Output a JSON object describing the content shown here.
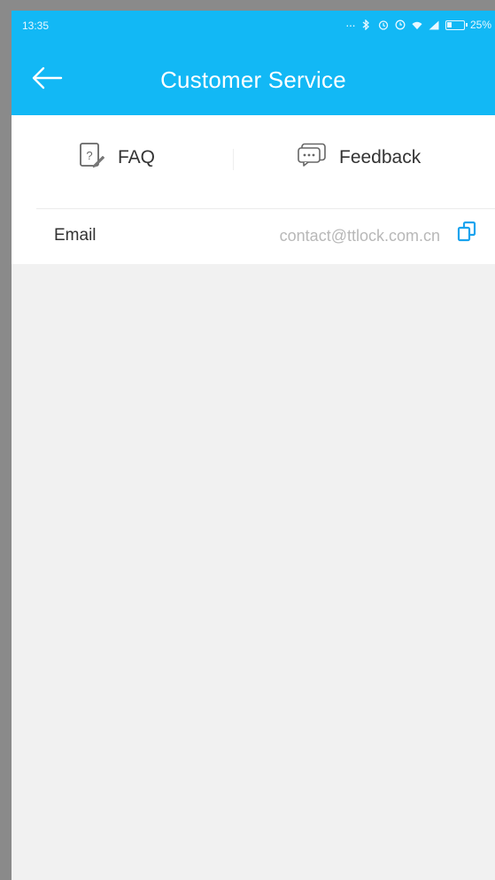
{
  "status_bar": {
    "time": "13:35",
    "battery_text": "25%",
    "battery_level": 0.25,
    "icons": [
      "ellipsis-icon",
      "bluetooth-icon",
      "alarm-icon",
      "clock-icon",
      "wifi-icon",
      "signal-icon",
      "battery-icon"
    ]
  },
  "header": {
    "title": "Customer Service",
    "back_icon": "arrow-left-icon",
    "background_color": "#12b8f5"
  },
  "tabs": [
    {
      "label": "FAQ",
      "icon": "faq-icon"
    },
    {
      "label": "Feedback",
      "icon": "chat-bubble-icon"
    }
  ],
  "contact": {
    "label": "Email",
    "value": "contact@ttlock.com.cn",
    "action_icon": "copy-icon",
    "accent_color": "#1aa3ee"
  }
}
